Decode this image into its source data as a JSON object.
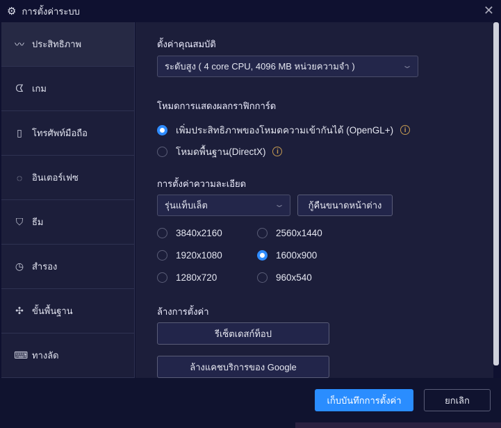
{
  "window": {
    "title": "การตั้งค่าระบบ"
  },
  "sidebar": {
    "items": [
      {
        "label": "ประสิทธิภาพ",
        "icon": "pulse-icon"
      },
      {
        "label": "เกม",
        "icon": "gamepad-icon"
      },
      {
        "label": "โทรศัพท์มือถือ",
        "icon": "phone-icon"
      },
      {
        "label": "อินเตอร์เฟซ",
        "icon": "palette-icon"
      },
      {
        "label": "ธีม",
        "icon": "shirt-icon"
      },
      {
        "label": "สำรอง",
        "icon": "history-icon"
      },
      {
        "label": "ขั้นพื้นฐาน",
        "icon": "puzzle-icon"
      },
      {
        "label": "ทางลัด",
        "icon": "keyboard-icon"
      }
    ]
  },
  "performance": {
    "heading": "ตั้งค่าคุณสมบัติ",
    "value": "ระดับสูง ( 4 core CPU, 4096 MB หน่วยความจำ )"
  },
  "graphics": {
    "heading": "โหมดการแสดงผลกราฟิกการ์ด",
    "options": [
      "เพิ่มประสิทธิภาพของโหมดความเข้ากันได้ (OpenGL+)",
      "โหมดพื้นฐาน(DirectX)"
    ],
    "selected": 0
  },
  "resolution": {
    "heading": "การตั้งค่าความละเอียด",
    "device": "รุ่นแท็บเล็ต",
    "restore_label": "กู้คืนขนาดหน้าต่าง",
    "options": [
      "3840x2160",
      "2560x1440",
      "1920x1080",
      "1600x900",
      "1280x720",
      "960x540"
    ],
    "selected": "1600x900"
  },
  "reset": {
    "heading": "ล้างการตั้งค่า",
    "reset_desktop": "รีเซ็ตเดสก์ท็อป",
    "clear_google": "ล้างแคชบริการของ Google"
  },
  "footer": {
    "save": "เก็บบันทึกการตั้งค่า",
    "cancel": "ยกเลิก"
  },
  "colors": {
    "accent": "#2a8dff",
    "panel": "#1c1e3a",
    "titlebar": "#0f1130"
  }
}
